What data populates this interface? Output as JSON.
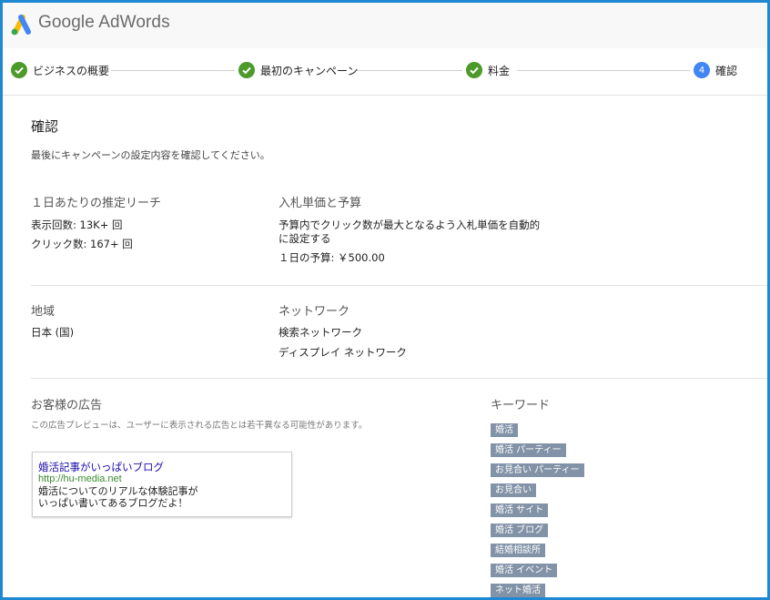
{
  "app": {
    "logo_text": "Google AdWords"
  },
  "steps": [
    {
      "label": "ビジネスの概要",
      "state": "done"
    },
    {
      "label": "最初のキャンペーン",
      "state": "done"
    },
    {
      "label": "料金",
      "state": "done"
    },
    {
      "label": "確認",
      "state": "current",
      "number": "4"
    }
  ],
  "page": {
    "title": "確認",
    "subtitle": "最後にキャンペーンの設定内容を確認してください。"
  },
  "reach": {
    "heading": "１日あたりの推定リーチ",
    "impressions": "表示回数: 13K+ 回",
    "clicks": "クリック数: 167+ 回"
  },
  "bidding": {
    "heading": "入札単価と予算",
    "strategy_line1": "予算内でクリック数が最大となるよう入札単価を自動的",
    "strategy_line2": "に設定する",
    "budget": "１日の予算: ￥500.00"
  },
  "location": {
    "heading": "地域",
    "value": "日本 (国)"
  },
  "network": {
    "heading": "ネットワーク",
    "items": [
      "検索ネットワーク",
      "ディスプレイ ネットワーク"
    ]
  },
  "ad": {
    "heading": "お客様の広告",
    "note": "この広告プレビューは、ユーザーに表示される広告とは若干異なる可能性があります。",
    "title": "婚活記事がいっぱいブログ",
    "url": "http://hu-media.net",
    "desc_line1": "婚活についてのリアルな体験記事が",
    "desc_line2": "いっぱい書いてあるブログだよ！"
  },
  "keywords": {
    "heading": "キーワード",
    "items": [
      "婚活",
      "婚活 パーティー",
      "お見合い パーティー",
      "お見合い",
      "婚活 サイト",
      "婚活 ブログ",
      "結婚相談所",
      "婚活 イベント",
      "ネット婚活"
    ]
  },
  "colors": {
    "frame": "#1e88d2",
    "check": "#4c9a2a",
    "current_step": "#4285f4",
    "keyword_chip": "#8393a7",
    "ad_title": "#1a0dab",
    "ad_url": "#3b8a2f"
  }
}
